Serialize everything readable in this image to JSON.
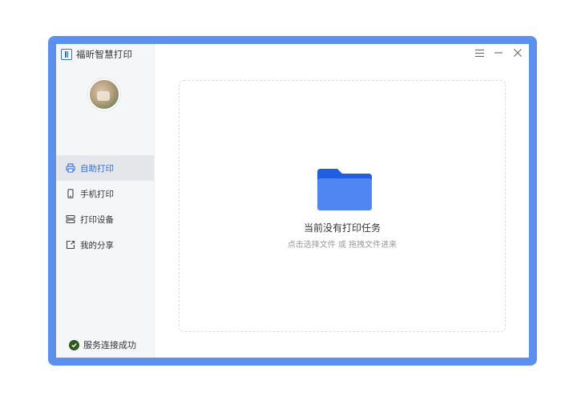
{
  "app": {
    "title": "福昕智慧打印"
  },
  "window_controls": [
    {
      "icon": "menu-icon"
    },
    {
      "icon": "minimize-icon"
    },
    {
      "icon": "close-icon"
    }
  ],
  "sidebar": {
    "items": [
      {
        "label": "自助打印",
        "icon": "printer-icon",
        "active": true
      },
      {
        "label": "手机打印",
        "icon": "phone-icon",
        "active": false
      },
      {
        "label": "打印设备",
        "icon": "server-icon",
        "active": false
      },
      {
        "label": "我的分享",
        "icon": "share-icon",
        "active": false
      }
    ],
    "status": {
      "text": "服务连接成功",
      "icon": "check-circle-icon",
      "color": "#2d5a1c"
    }
  },
  "main": {
    "empty_title": "当前没有打印任务",
    "empty_hint": "点击选择文件 或 拖拽文件进来",
    "folder_icon": "folder-icon"
  },
  "colors": {
    "accent": "#2f6de6",
    "frame": "#5b8ff0",
    "folder": "#4f86f2",
    "folder_back": "#1f5fe0"
  }
}
